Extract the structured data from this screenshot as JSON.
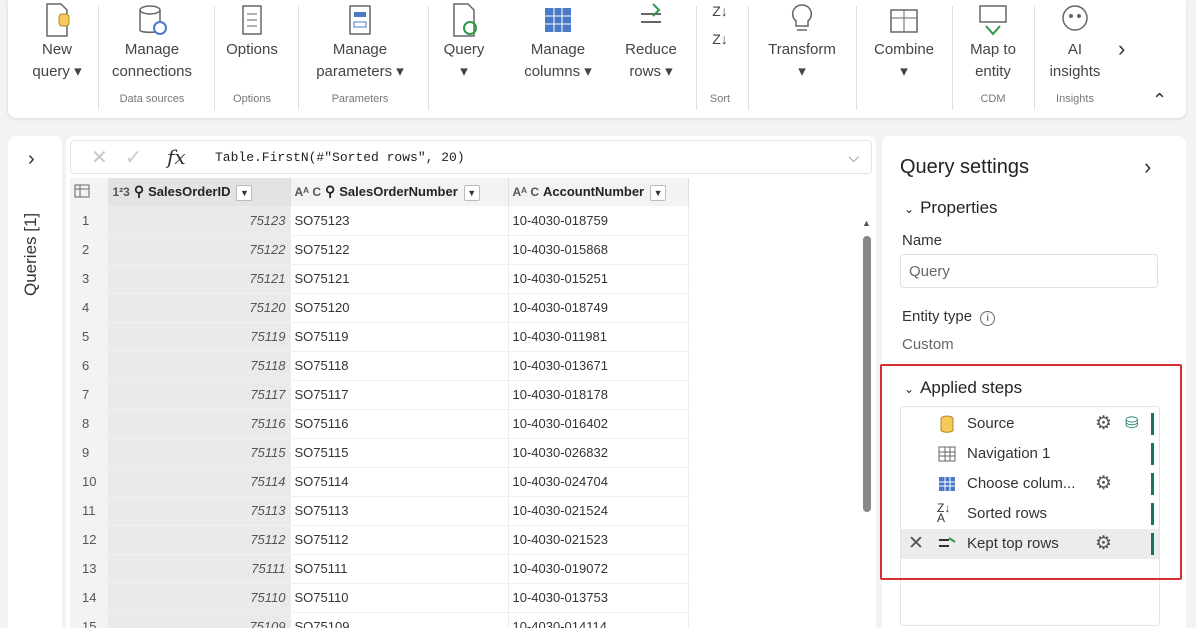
{
  "ribbon": {
    "buttons": [
      {
        "label": "New\nquery ▾",
        "icon": "new-query-icon"
      },
      {
        "label": "Manage\nconnections",
        "icon": "manage-connections-icon"
      },
      {
        "label": "Options",
        "icon": "options-icon"
      },
      {
        "label": "Manage\nparameters ▾",
        "icon": "manage-parameters-icon"
      },
      {
        "label": "Query\n▾",
        "icon": "query-icon"
      },
      {
        "label": "Manage\ncolumns ▾",
        "icon": "manage-columns-icon"
      },
      {
        "label": "Reduce\nrows ▾",
        "icon": "reduce-rows-icon"
      },
      {
        "label": "Transform\n▾",
        "icon": "transform-icon"
      },
      {
        "label": "Combine\n▾",
        "icon": "combine-icon"
      },
      {
        "label": "Map to\nentity",
        "icon": "map-to-entity-icon"
      },
      {
        "label": "AI\ninsights",
        "icon": "ai-insights-icon"
      }
    ],
    "groups": [
      "Data sources",
      "Options",
      "Parameters",
      "Sort",
      "CDM",
      "Insights"
    ]
  },
  "queries_pane": {
    "label": "Queries [1]"
  },
  "formula_bar": {
    "text": "Table.FirstN(#\"Sorted rows\", 20)"
  },
  "grid": {
    "columns": [
      {
        "type": "1²3",
        "name": "SalesOrderID"
      },
      {
        "type": "Aᴬ C",
        "name": "SalesOrderNumber"
      },
      {
        "type": "Aᴬ C",
        "name": "AccountNumber"
      }
    ],
    "rows": [
      {
        "n": "1",
        "id": "75123",
        "num": "SO75123",
        "acc": "10-4030-018759"
      },
      {
        "n": "2",
        "id": "75122",
        "num": "SO75122",
        "acc": "10-4030-015868"
      },
      {
        "n": "3",
        "id": "75121",
        "num": "SO75121",
        "acc": "10-4030-015251"
      },
      {
        "n": "4",
        "id": "75120",
        "num": "SO75120",
        "acc": "10-4030-018749"
      },
      {
        "n": "5",
        "id": "75119",
        "num": "SO75119",
        "acc": "10-4030-011981"
      },
      {
        "n": "6",
        "id": "75118",
        "num": "SO75118",
        "acc": "10-4030-013671"
      },
      {
        "n": "7",
        "id": "75117",
        "num": "SO75117",
        "acc": "10-4030-018178"
      },
      {
        "n": "8",
        "id": "75116",
        "num": "SO75116",
        "acc": "10-4030-016402"
      },
      {
        "n": "9",
        "id": "75115",
        "num": "SO75115",
        "acc": "10-4030-026832"
      },
      {
        "n": "10",
        "id": "75114",
        "num": "SO75114",
        "acc": "10-4030-024704"
      },
      {
        "n": "11",
        "id": "75113",
        "num": "SO75113",
        "acc": "10-4030-021524"
      },
      {
        "n": "12",
        "id": "75112",
        "num": "SO75112",
        "acc": "10-4030-021523"
      },
      {
        "n": "13",
        "id": "75111",
        "num": "SO75111",
        "acc": "10-4030-019072"
      },
      {
        "n": "14",
        "id": "75110",
        "num": "SO75110",
        "acc": "10-4030-013753"
      },
      {
        "n": "15",
        "id": "75109",
        "num": "SO75109",
        "acc": "10-4030-014114"
      }
    ]
  },
  "query_settings": {
    "title": "Query settings",
    "properties_label": "Properties",
    "name_label": "Name",
    "name_value": "Query",
    "entity_type_label": "Entity type",
    "entity_type_value": "Custom",
    "applied_steps_label": "Applied steps",
    "steps": [
      {
        "label": "Source",
        "icon": "source-cylinder-icon",
        "gear": true
      },
      {
        "label": "Navigation 1",
        "icon": "table-icon",
        "gear": false
      },
      {
        "label": "Choose colum...",
        "icon": "choose-columns-icon",
        "gear": true
      },
      {
        "label": "Sorted rows",
        "icon": "sort-za-icon",
        "gear": false
      },
      {
        "label": "Kept top rows",
        "icon": "keep-top-rows-icon",
        "gear": true
      }
    ]
  },
  "colors": {
    "accent": "#117865",
    "highlight_border": "#d32f2f"
  }
}
